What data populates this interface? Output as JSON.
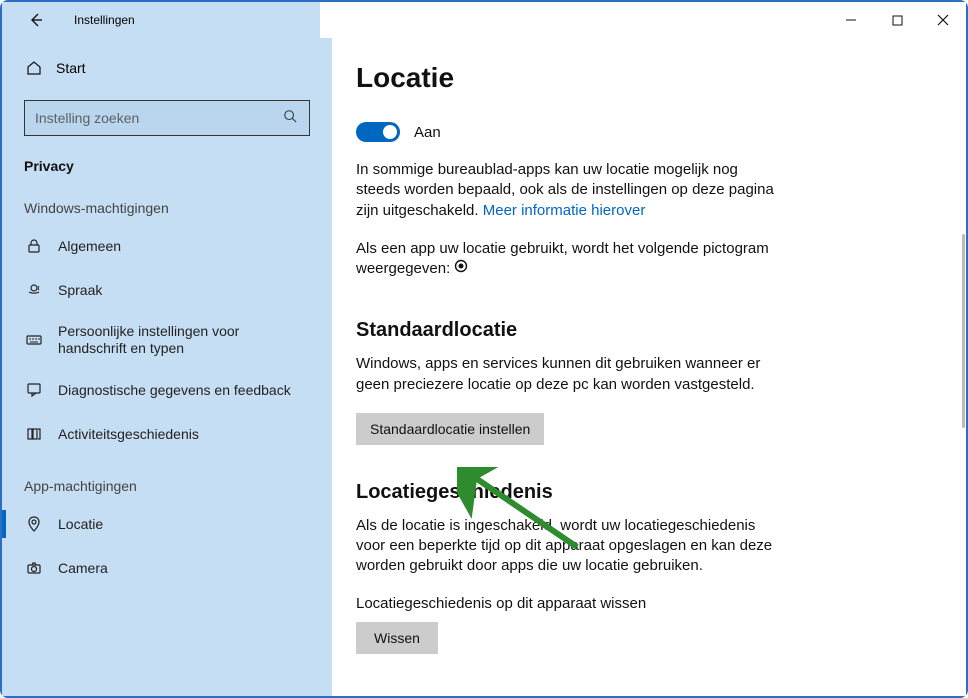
{
  "titlebar": {
    "title": "Instellingen"
  },
  "sidebar": {
    "start_label": "Start",
    "search_placeholder": "Instelling zoeken",
    "privacy_label": "Privacy",
    "group1_label": "Windows-machtigingen",
    "items1": [
      {
        "label": "Algemeen"
      },
      {
        "label": "Spraak"
      },
      {
        "label": "Persoonlijke instellingen voor handschrift en typen"
      },
      {
        "label": "Diagnostische gegevens en feedback"
      },
      {
        "label": "Activiteitsgeschiedenis"
      }
    ],
    "group2_label": "App-machtigingen",
    "items2": [
      {
        "label": "Locatie"
      },
      {
        "label": "Camera"
      }
    ]
  },
  "main": {
    "title": "Locatie",
    "toggle_label": "Aan",
    "para1_a": "In sommige bureaublad-apps kan uw locatie mogelijk nog steeds worden bepaald, ook als de instellingen op deze pagina zijn uitgeschakeld. ",
    "para1_link": "Meer informatie hierover",
    "para2": "Als een app uw locatie gebruikt, wordt het volgende pictogram weergegeven: ",
    "h2a": "Standaardlocatie",
    "para3": "Windows, apps en services kunnen dit gebruiken wanneer er geen preciezere locatie op deze pc kan worden vastgesteld.",
    "btn_set_default": "Standaardlocatie instellen",
    "h2b": "Locatiegeschiedenis",
    "para4": "Als de locatie is ingeschakeld, wordt uw locatiegeschiedenis voor een beperkte tijd op dit apparaat opgeslagen en kan deze worden gebruikt door apps die uw locatie gebruiken.",
    "sub_clear": "Locatiegeschiedenis op dit apparaat wissen",
    "btn_clear": "Wissen"
  }
}
